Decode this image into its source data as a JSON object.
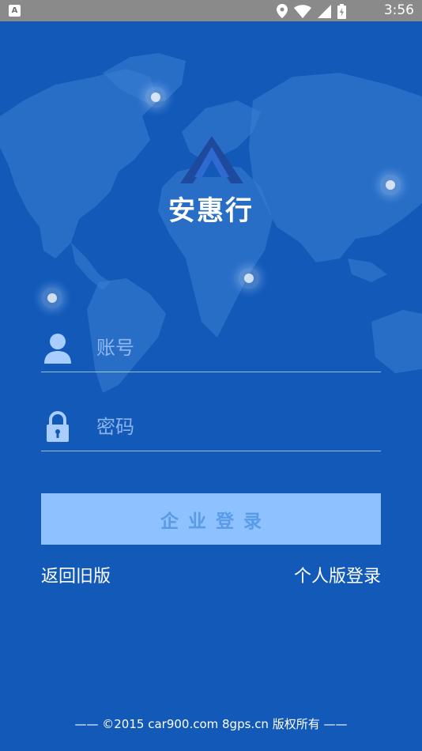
{
  "status_bar": {
    "app_icon_letter": "A",
    "time": "3:56"
  },
  "brand": {
    "app_name": "安惠行"
  },
  "login_form": {
    "account_placeholder": "账号",
    "password_placeholder": "密码",
    "login_button_label": "企业登录"
  },
  "links": {
    "back_to_old_version": "返回旧版",
    "personal_login": "个人版登录"
  },
  "footer": {
    "copyright": "—— ©2015 car900.com 8gps.cn 版权所有 ——"
  },
  "colors": {
    "background": "#1259b8",
    "status_bar": "#8a8a8a",
    "button": "#8ec1ff",
    "button_text": "#5a9be6",
    "logo": "#1e4a9e"
  },
  "icons": [
    "app-icon",
    "location-icon",
    "wifi-icon",
    "signal-icon",
    "battery-icon",
    "user-icon",
    "lock-icon"
  ]
}
